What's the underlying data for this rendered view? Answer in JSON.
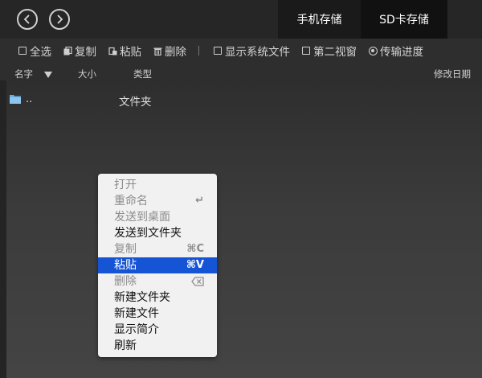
{
  "nav": {
    "back_icon": "chevron-left-icon",
    "forward_icon": "chevron-right-icon"
  },
  "storage_tabs": {
    "phone": "手机存储",
    "sd": "SD卡存储"
  },
  "toolbar": {
    "select_all": "全选",
    "copy": "复制",
    "paste": "粘贴",
    "delete": "删除",
    "show_system_files": "显示系统文件",
    "second_view": "第二视窗",
    "transfer_progress": "传输进度"
  },
  "columns": {
    "name": "名字",
    "size": "大小",
    "type": "类型",
    "modified": "修改日期"
  },
  "files": [
    {
      "name": "..",
      "type": "文件夹"
    }
  ],
  "context_menu": {
    "items": [
      {
        "label": "打开",
        "shortcut": "",
        "disabled": true
      },
      {
        "label": "重命名",
        "shortcut": "↵",
        "disabled": true
      },
      {
        "label": "发送到桌面",
        "shortcut": "",
        "disabled": true
      },
      {
        "label": "发送到文件夹",
        "shortcut": "",
        "disabled": false
      },
      {
        "label": "复制",
        "shortcut": "⌘C",
        "disabled": true
      },
      {
        "label": "粘贴",
        "shortcut": "⌘V",
        "disabled": false,
        "selected": true
      },
      {
        "label": "删除",
        "shortcut": "⌦",
        "disabled": true
      },
      {
        "label": "新建文件夹",
        "shortcut": "",
        "disabled": false
      },
      {
        "label": "新建文件",
        "shortcut": "",
        "disabled": false
      },
      {
        "label": "显示简介",
        "shortcut": "",
        "disabled": false
      },
      {
        "label": "刷新",
        "shortcut": "",
        "disabled": false
      }
    ]
  },
  "colors": {
    "accent": "#1555d5",
    "background": "#2e2e2e",
    "menu_bg": "#f1f1f1"
  }
}
